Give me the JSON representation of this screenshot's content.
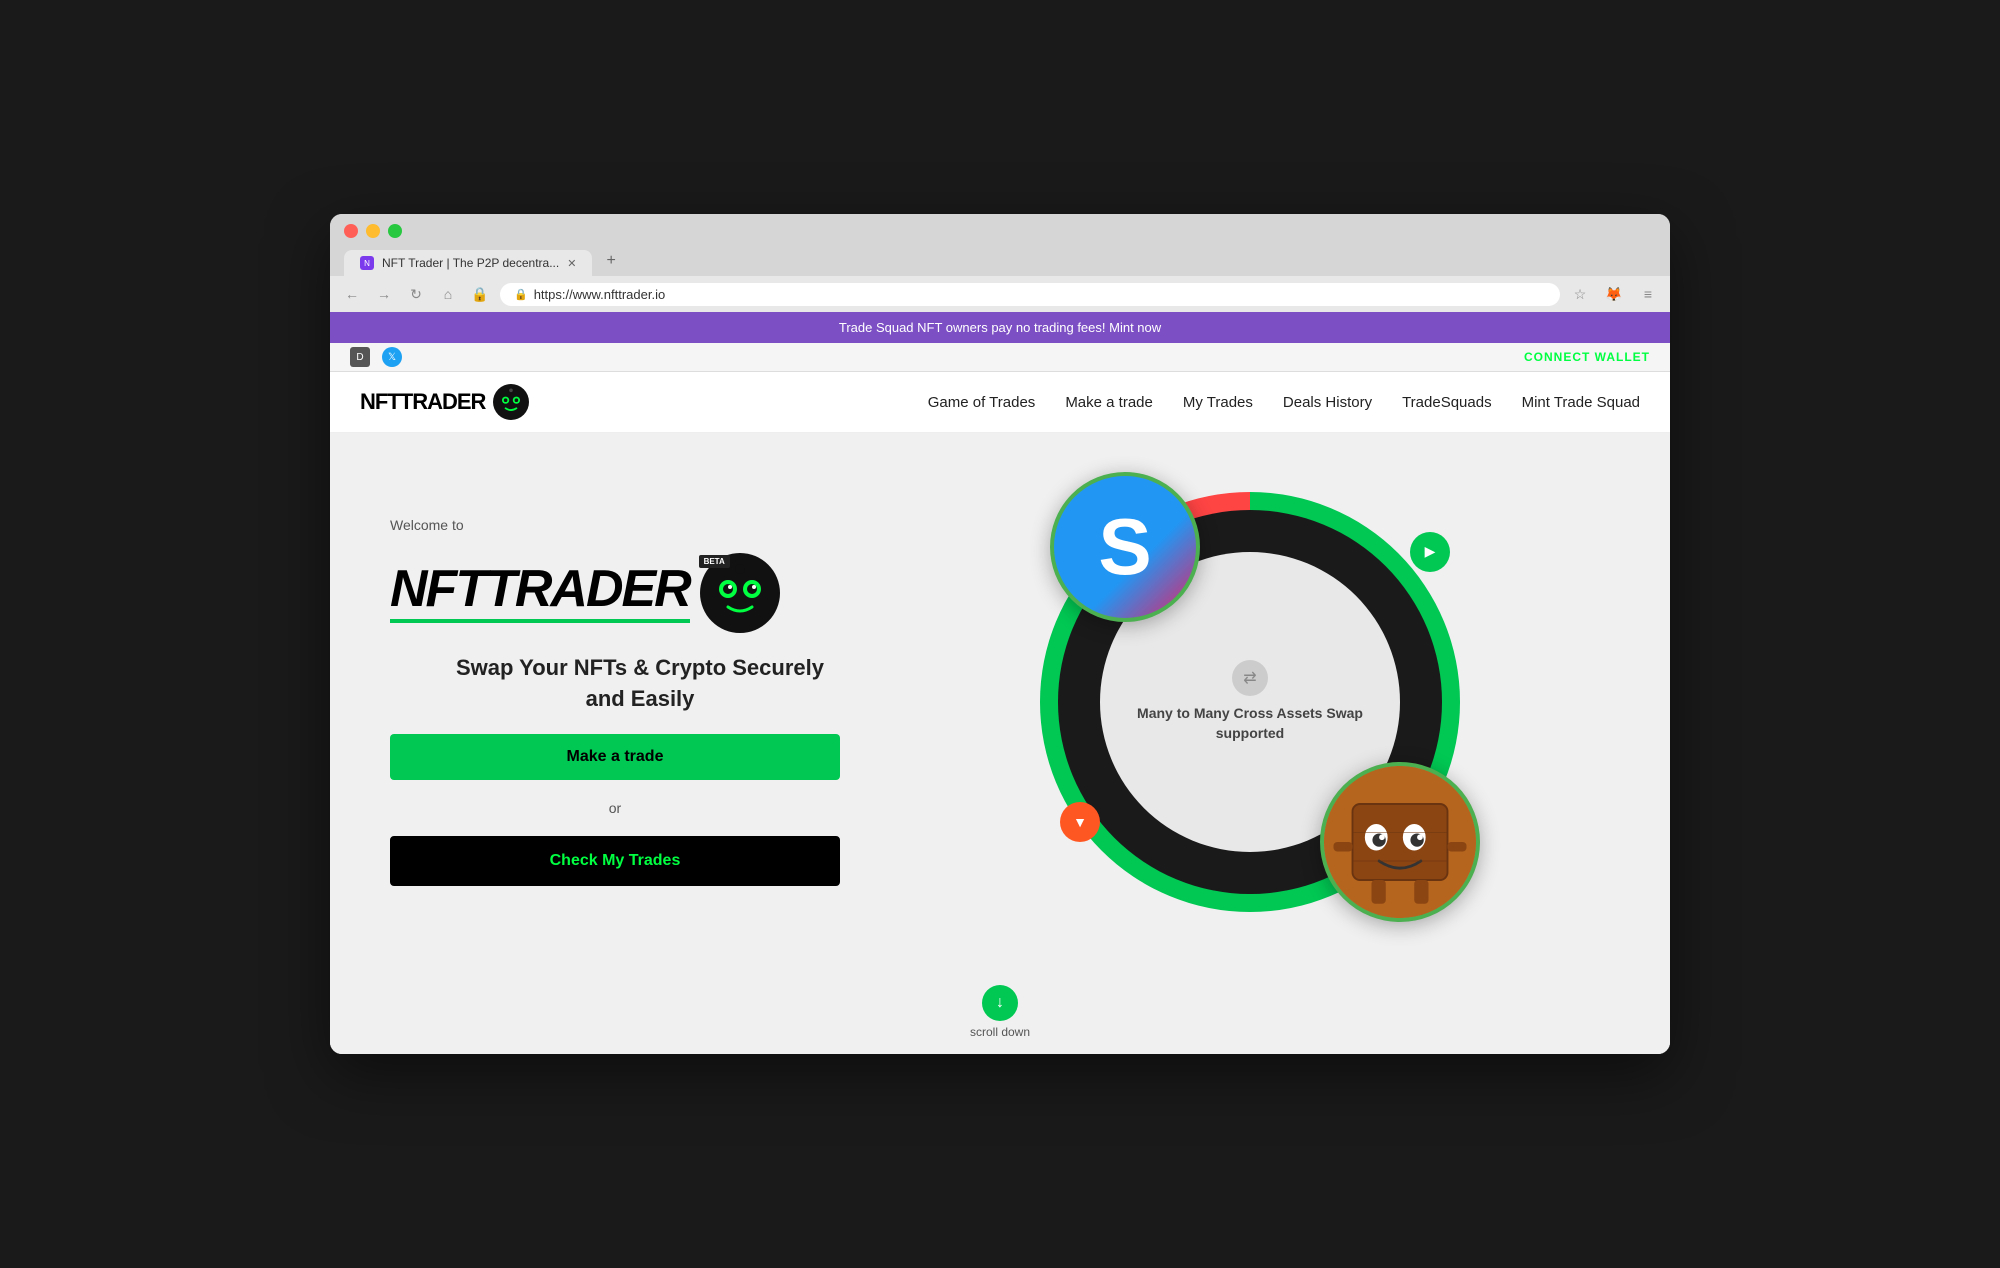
{
  "browser": {
    "tab_title": "NFT Trader | The P2P decentra...",
    "url": "https://www.nfttrader.io",
    "new_tab_label": "+"
  },
  "promo_banner": {
    "text": "Trade Squad NFT owners pay no trading fees! Mint now"
  },
  "social_bar": {
    "discord_label": "D",
    "twitter_label": "t",
    "connect_wallet_label": "CONNECT WALLET"
  },
  "nav": {
    "logo_text": "NFTTRADER",
    "links": [
      {
        "label": "Game of Trades",
        "id": "game-of-trades"
      },
      {
        "label": "Make a trade",
        "id": "make-a-trade"
      },
      {
        "label": "My Trades",
        "id": "my-trades"
      },
      {
        "label": "Deals History",
        "id": "deals-history"
      },
      {
        "label": "TradeSquads",
        "id": "trade-squads"
      },
      {
        "label": "Mint Trade Squad",
        "id": "mint-trade-squad"
      }
    ]
  },
  "hero": {
    "welcome_text": "Welcome to",
    "brand_name": "NFTTRADER",
    "beta_badge": "BETA",
    "tagline_line1": "Swap Your NFTs & Crypto Securely",
    "tagline_line2": "and Easily",
    "make_trade_btn": "Make a trade",
    "or_text": "or",
    "check_trades_btn": "Check My Trades"
  },
  "viz": {
    "swap_label_line1": "Many to Many Cross Assets Swap",
    "swap_label_line2": "supported"
  },
  "scroll": {
    "text": "scroll down"
  },
  "colors": {
    "green": "#00c853",
    "purple": "#7c4fc4",
    "black": "#000000",
    "white": "#ffffff"
  }
}
